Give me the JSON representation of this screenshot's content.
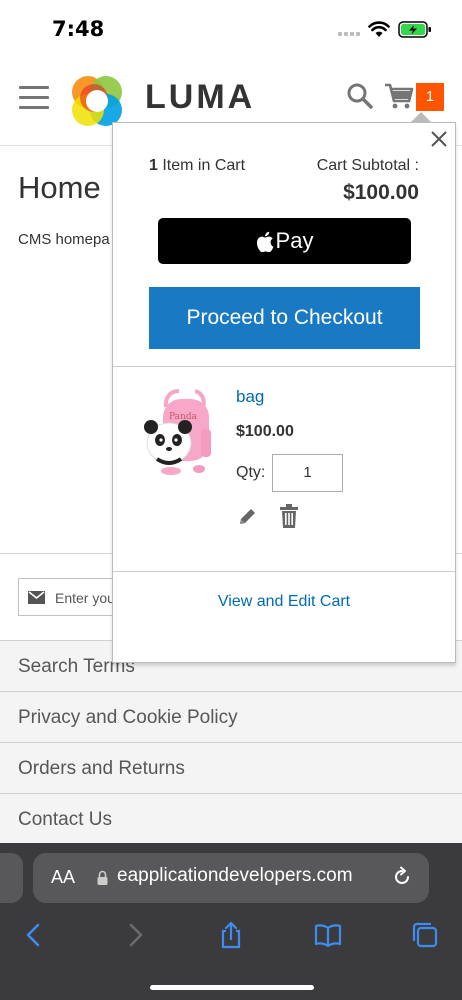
{
  "status_bar": {
    "time": "7:48"
  },
  "header": {
    "logo_text": "LUMA",
    "cart_count": "1"
  },
  "page": {
    "title": "Home",
    "text": "CMS homepa"
  },
  "newsletter": {
    "placeholder": "Enter you"
  },
  "footer": {
    "links": [
      "Search Terms",
      "Privacy and Cookie Policy",
      "Orders and Returns",
      "Contact Us"
    ]
  },
  "minicart": {
    "item_count": "1",
    "item_label": "Item in Cart",
    "subtotal_label": "Cart Subtotal :",
    "subtotal_amount": "$100.00",
    "apple_pay_label": "Pay",
    "checkout_label": "Proceed to Checkout",
    "item": {
      "name": "bag",
      "price": "$100.00",
      "qty_label": "Qty:",
      "qty_value": "1"
    },
    "view_cart_label": "View and Edit Cart"
  },
  "safari": {
    "aa_label": "AA",
    "url": "eapplicationdevelopers.com"
  },
  "colors": {
    "accent_blue": "#1979c3",
    "link_blue": "#006bb4",
    "cart_badge": "#ff5501",
    "battery_green": "#32d74b"
  }
}
